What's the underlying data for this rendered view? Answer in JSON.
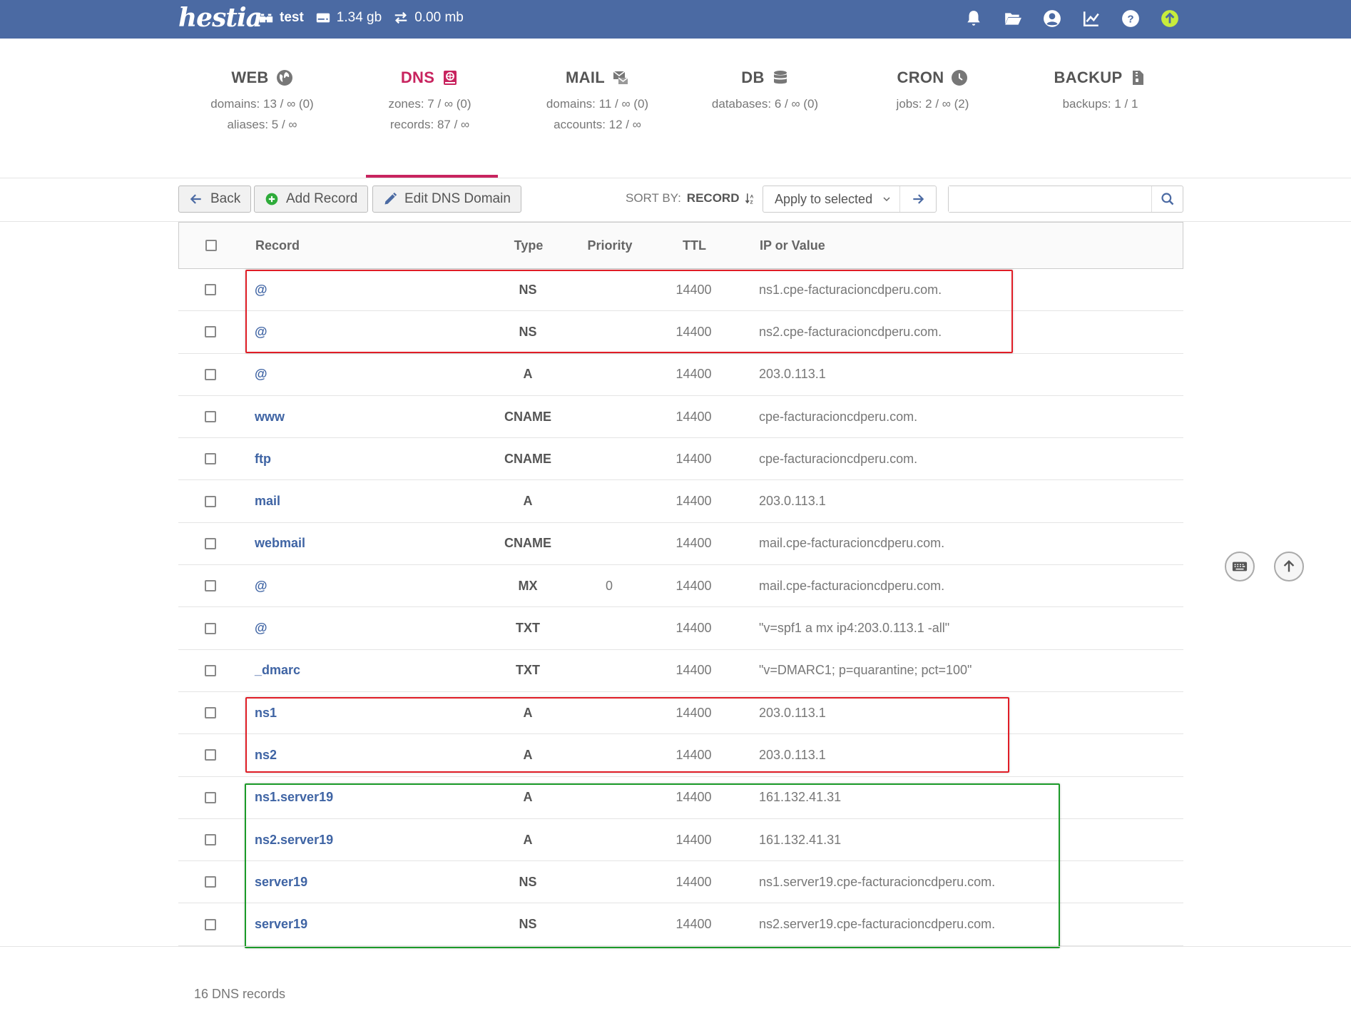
{
  "topbar": {
    "logo": "hestia",
    "user": "test",
    "disk": "1.34 gb",
    "bandwidth": "0.00 mb",
    "accent": "#4b6aa3"
  },
  "panels": [
    {
      "title": "WEB",
      "icon": "globe-icon",
      "line1": "domains: 13 / ∞ (0)",
      "line2": "aliases: 5 / ∞"
    },
    {
      "title": "DNS",
      "icon": "book-icon",
      "line1": "zones: 7 / ∞ (0)",
      "line2": "records: 87 / ∞"
    },
    {
      "title": "MAIL",
      "icon": "mail-icon",
      "line1": "domains: 11 / ∞ (0)",
      "line2": "accounts: 12 / ∞"
    },
    {
      "title": "DB",
      "icon": "database-icon",
      "line1": "databases: 6 / ∞ (0)",
      "line2": ""
    },
    {
      "title": "CRON",
      "icon": "clock-icon",
      "line1": "jobs: 2 / ∞ (2)",
      "line2": ""
    },
    {
      "title": "BACKUP",
      "icon": "file-icon",
      "line1": "backups: 1 / 1",
      "line2": ""
    }
  ],
  "toolbar": {
    "back": "Back",
    "add_record": "Add Record",
    "edit_domain": "Edit DNS Domain",
    "sort_label": "SORT BY:",
    "sort_value": "RECORD",
    "apply_select": "Apply to selected",
    "search_placeholder": ""
  },
  "table": {
    "headers": {
      "record": "Record",
      "type": "Type",
      "priority": "Priority",
      "ttl": "TTL",
      "value": "IP or Value"
    },
    "rows": [
      {
        "record": "@",
        "type": "NS",
        "priority": "",
        "ttl": "14400",
        "value": "ns1.cpe-facturacioncdperu.com."
      },
      {
        "record": "@",
        "type": "NS",
        "priority": "",
        "ttl": "14400",
        "value": "ns2.cpe-facturacioncdperu.com."
      },
      {
        "record": "@",
        "type": "A",
        "priority": "",
        "ttl": "14400",
        "value": "203.0.113.1"
      },
      {
        "record": "www",
        "type": "CNAME",
        "priority": "",
        "ttl": "14400",
        "value": "cpe-facturacioncdperu.com."
      },
      {
        "record": "ftp",
        "type": "CNAME",
        "priority": "",
        "ttl": "14400",
        "value": "cpe-facturacioncdperu.com."
      },
      {
        "record": "mail",
        "type": "A",
        "priority": "",
        "ttl": "14400",
        "value": "203.0.113.1"
      },
      {
        "record": "webmail",
        "type": "CNAME",
        "priority": "",
        "ttl": "14400",
        "value": "mail.cpe-facturacioncdperu.com."
      },
      {
        "record": "@",
        "type": "MX",
        "priority": "0",
        "ttl": "14400",
        "value": "mail.cpe-facturacioncdperu.com."
      },
      {
        "record": "@",
        "type": "TXT",
        "priority": "",
        "ttl": "14400",
        "value": "\"v=spf1 a mx ip4:203.0.113.1 -all\""
      },
      {
        "record": "_dmarc",
        "type": "TXT",
        "priority": "",
        "ttl": "14400",
        "value": "\"v=DMARC1; p=quarantine; pct=100\""
      },
      {
        "record": "ns1",
        "type": "A",
        "priority": "",
        "ttl": "14400",
        "value": "203.0.113.1"
      },
      {
        "record": "ns2",
        "type": "A",
        "priority": "",
        "ttl": "14400",
        "value": "203.0.113.1"
      },
      {
        "record": "ns1.server19",
        "type": "A",
        "priority": "",
        "ttl": "14400",
        "value": "161.132.41.31"
      },
      {
        "record": "ns2.server19",
        "type": "A",
        "priority": "",
        "ttl": "14400",
        "value": "161.132.41.31"
      },
      {
        "record": "server19",
        "type": "NS",
        "priority": "",
        "ttl": "14400",
        "value": "ns1.server19.cpe-facturacioncdperu.com."
      },
      {
        "record": "server19",
        "type": "NS",
        "priority": "",
        "ttl": "14400",
        "value": "ns2.server19.cpe-facturacioncdperu.com."
      }
    ]
  },
  "footer": {
    "count": "16 DNS records"
  },
  "colors": {
    "active_tab": "#c8245f",
    "link": "#3f64a4",
    "highlight_red": "#e01d26",
    "highlight_green": "#1b9a28"
  }
}
